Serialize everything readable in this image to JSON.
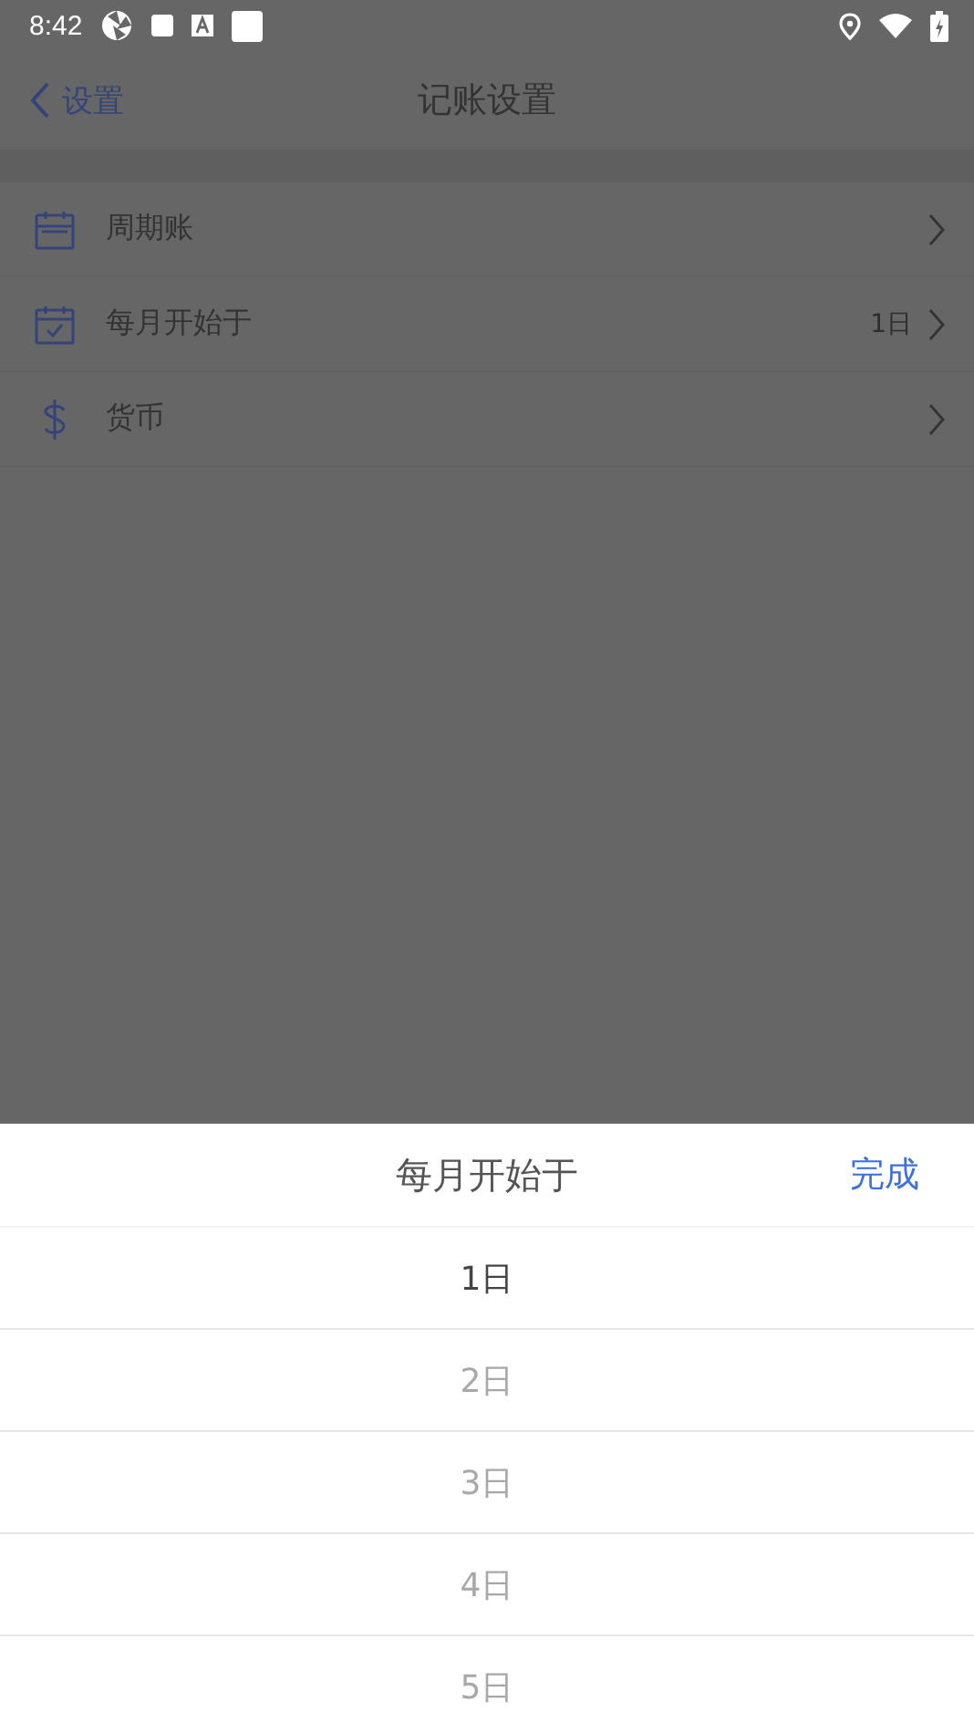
{
  "status_bar": {
    "time": "8:42"
  },
  "header": {
    "back_label": "设置",
    "title": "记账设置"
  },
  "settings": [
    {
      "kind": "calendar",
      "label": "周期账"
    },
    {
      "kind": "calendar-check",
      "label": "每月开始于",
      "value": "1日"
    },
    {
      "kind": "currency",
      "label": "货币"
    }
  ],
  "picker": {
    "title": "每月开始于",
    "done": "完成",
    "options": [
      {
        "label": "1日",
        "selected": true
      },
      {
        "label": "2日",
        "selected": false
      },
      {
        "label": "3日",
        "selected": false
      },
      {
        "label": "4日",
        "selected": false
      },
      {
        "label": "5日",
        "selected": false
      }
    ]
  }
}
